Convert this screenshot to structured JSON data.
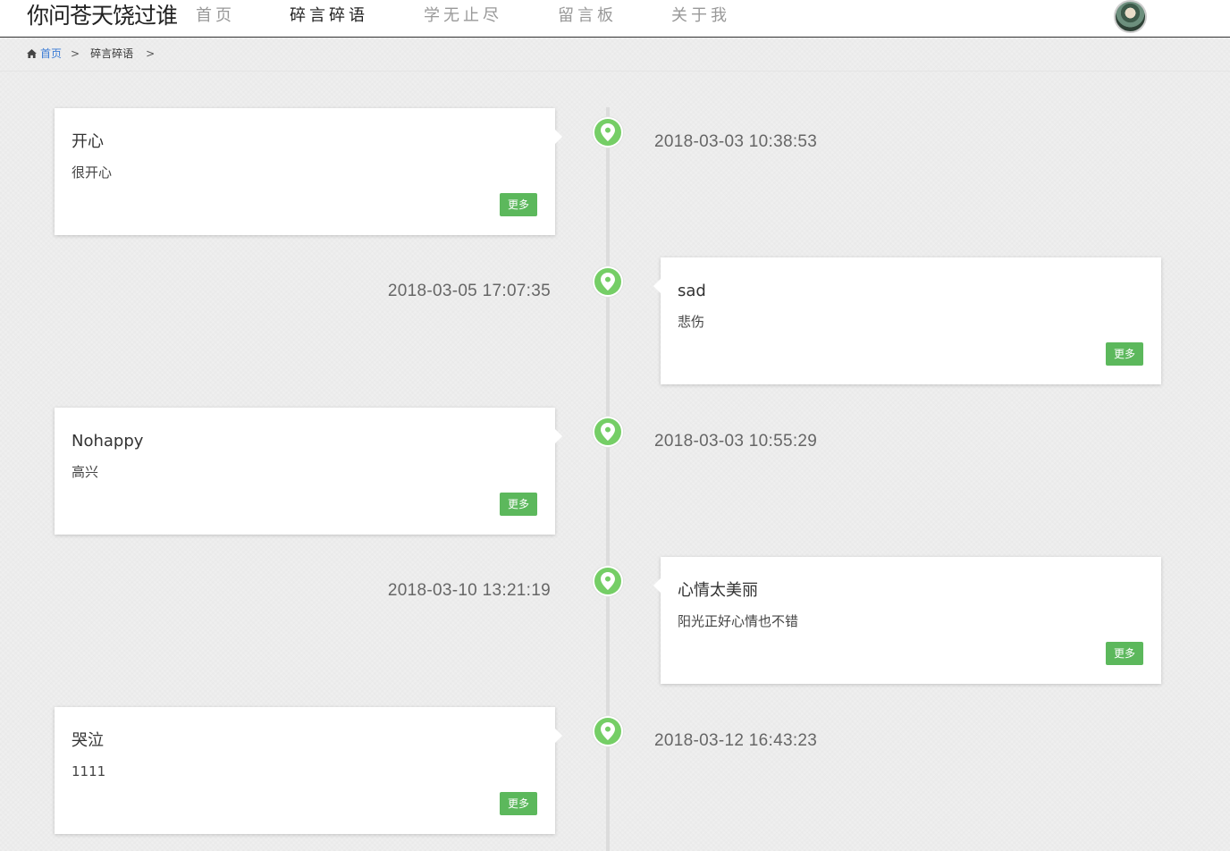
{
  "header": {
    "site_title": "你问苍天饶过谁",
    "nav": [
      {
        "label": "首页",
        "active": false
      },
      {
        "label": "碎言碎语",
        "active": true
      },
      {
        "label": "学无止尽",
        "active": false
      },
      {
        "label": "留言板",
        "active": false
      },
      {
        "label": "关于我",
        "active": false
      }
    ],
    "avatar_icon": "user-avatar"
  },
  "breadcrumb": {
    "home_icon": "home-icon",
    "home_label": "首页",
    "current_label": "碎言碎语",
    "separator": ">"
  },
  "timeline": {
    "pin_icon": "map-marker-icon",
    "accent_color": "#75ce66",
    "button_color": "#5cb85c",
    "entries": [
      {
        "title": "开心",
        "text": "很开心",
        "date": "2018-03-03 10:38:53",
        "more_label": "更多",
        "side": "left"
      },
      {
        "title": "sad",
        "text": "悲伤",
        "date": "2018-03-05 17:07:35",
        "more_label": "更多",
        "side": "right"
      },
      {
        "title": "Nohappy",
        "text": "高兴",
        "date": "2018-03-03 10:55:29",
        "more_label": "更多",
        "side": "left"
      },
      {
        "title": "心情太美丽",
        "text": "阳光正好心情也不错",
        "date": "2018-03-10 13:21:19",
        "more_label": "更多",
        "side": "right"
      },
      {
        "title": "哭泣",
        "text": "1111",
        "date": "2018-03-12 16:43:23",
        "more_label": "更多",
        "side": "left"
      }
    ]
  }
}
